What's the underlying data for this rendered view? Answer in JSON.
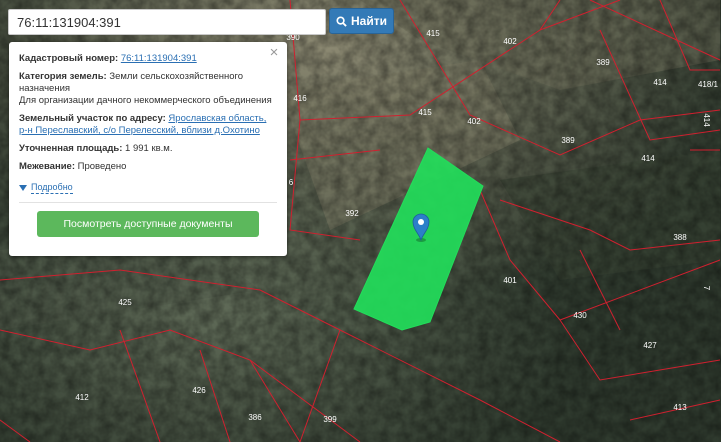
{
  "search": {
    "value": "76:11:131904:391",
    "button_label": "Найти",
    "button_icon": "search-icon"
  },
  "info": {
    "close_icon": "close-icon",
    "cadastral_label": "Кадастровый номер:",
    "cadastral_value": "76:11:131904:391",
    "category_label": "Категория земель:",
    "category_value": "Земли сельскохозяйственного назначения",
    "usage_value": "Для организации дачного некоммерческого объединения",
    "address_label": "Земельный участок по адресу:",
    "address_value": "Ярославская область, р-н Переславский, с/о Перелесский, вблизи д.Охотино",
    "area_label": "Уточненная площадь:",
    "area_value": "1 991 кв.м.",
    "survey_label": "Межевание:",
    "survey_value": "Проведено",
    "more_label": "Подробно",
    "docs_button": "Посмотреть доступные документы"
  },
  "map": {
    "parcel_labels": [
      "390",
      "415",
      "402",
      "389",
      "414",
      "418/1",
      "414",
      "416",
      "415",
      "402",
      "389",
      "414",
      "6",
      "392",
      "388",
      "401",
      "425",
      "430",
      "427",
      "7",
      "412",
      "426",
      "386",
      "399",
      "413"
    ],
    "colors": {
      "boundary": "#d0202f",
      "highlight": "#22dd5a",
      "marker": "#2c7fc9"
    }
  }
}
